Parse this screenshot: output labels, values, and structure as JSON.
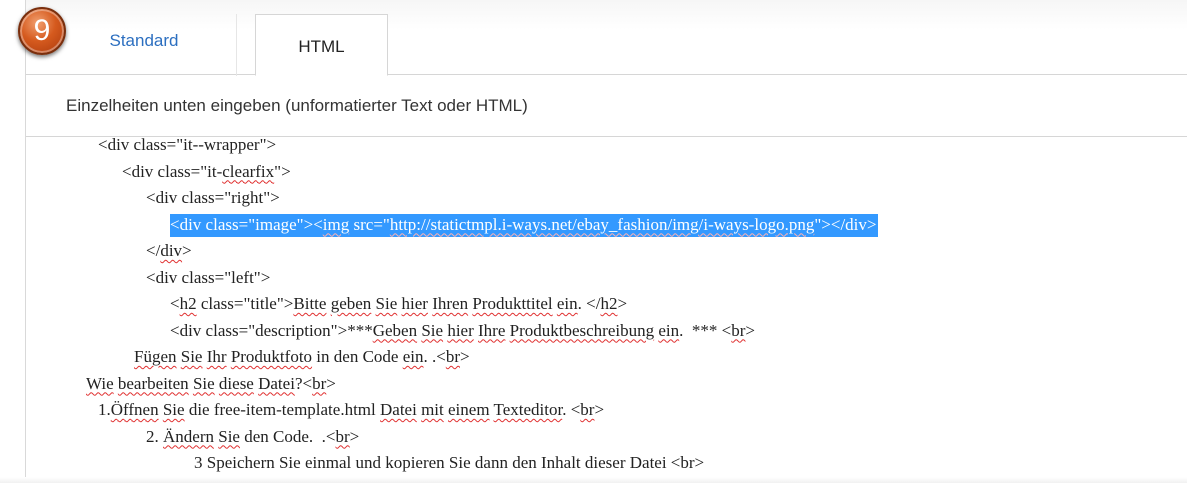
{
  "badge": {
    "number": "9"
  },
  "tabs": [
    {
      "label": "Standard",
      "active": false
    },
    {
      "label": "HTML",
      "active": true
    }
  ],
  "instructions": "Einzelheiten unten eingeben (unformatierter Text oder HTML)",
  "colors": {
    "selection": "#3399ff",
    "tab_link": "#2c6fc0",
    "badge": "#d55a1e",
    "spellcheck": "#e03030"
  },
  "code_lines": [
    {
      "indent": 1,
      "selected": false,
      "segments": [
        {
          "text": "<div class=\"it--wrapper\">",
          "spell": false
        }
      ]
    },
    {
      "indent": 2,
      "selected": false,
      "segments": [
        {
          "text": "<div class=\"it-",
          "spell": false
        },
        {
          "text": "clearfix",
          "spell": true
        },
        {
          "text": "\">",
          "spell": false
        }
      ]
    },
    {
      "indent": 3,
      "selected": false,
      "segments": [
        {
          "text": "<div class=\"right\">",
          "spell": false
        }
      ]
    },
    {
      "indent": 4,
      "selected": true,
      "segments": [
        {
          "text": "<div class=\"image\"><",
          "spell": false
        },
        {
          "text": "img",
          "spell": true
        },
        {
          "text": " src=\"",
          "spell": false
        },
        {
          "text": "http://statictmpl.i-ways.net/ebay_fashion/img/i-ways-logo.png",
          "spell": true
        },
        {
          "text": "\"></div>",
          "spell": false
        }
      ]
    },
    {
      "indent": 3,
      "selected": false,
      "segments": [
        {
          "text": "</",
          "spell": false
        },
        {
          "text": "div",
          "spell": true
        },
        {
          "text": ">",
          "spell": false
        }
      ]
    },
    {
      "indent": 3,
      "selected": false,
      "segments": [
        {
          "text": "<div class=\"left\">",
          "spell": false
        }
      ]
    },
    {
      "indent": 4,
      "selected": false,
      "segments": [
        {
          "text": "<",
          "spell": false
        },
        {
          "text": "h2",
          "spell": true
        },
        {
          "text": " class=\"title\">",
          "spell": false
        },
        {
          "text": "Bitte",
          "spell": true
        },
        {
          "text": " ",
          "spell": false
        },
        {
          "text": "geben",
          "spell": true
        },
        {
          "text": " ",
          "spell": false
        },
        {
          "text": "Sie",
          "spell": true
        },
        {
          "text": " ",
          "spell": false
        },
        {
          "text": "hier",
          "spell": true
        },
        {
          "text": " ",
          "spell": false
        },
        {
          "text": "Ihren",
          "spell": true
        },
        {
          "text": " ",
          "spell": false
        },
        {
          "text": "Produkttitel",
          "spell": true
        },
        {
          "text": " ",
          "spell": false
        },
        {
          "text": "ein",
          "spell": true
        },
        {
          "text": ". </",
          "spell": false
        },
        {
          "text": "h2",
          "spell": true
        },
        {
          "text": ">",
          "spell": false
        }
      ]
    },
    {
      "indent": 4,
      "selected": false,
      "segments": [
        {
          "text": "<div class=\"description\">***",
          "spell": false
        },
        {
          "text": "Geben",
          "spell": true
        },
        {
          "text": " ",
          "spell": false
        },
        {
          "text": "Sie",
          "spell": true
        },
        {
          "text": " ",
          "spell": false
        },
        {
          "text": "hier",
          "spell": true
        },
        {
          "text": " ",
          "spell": false
        },
        {
          "text": "Ihre",
          "spell": true
        },
        {
          "text": " ",
          "spell": false
        },
        {
          "text": "Produktbeschreibung",
          "spell": true
        },
        {
          "text": " ",
          "spell": false
        },
        {
          "text": "ein",
          "spell": true
        },
        {
          "text": ".  *** <",
          "spell": false
        },
        {
          "text": "br",
          "spell": true
        },
        {
          "text": ">",
          "spell": false
        }
      ]
    },
    {
      "indent": 2.5,
      "selected": false,
      "segments": [
        {
          "text": "Fügen",
          "spell": true
        },
        {
          "text": " ",
          "spell": false
        },
        {
          "text": "Sie",
          "spell": true
        },
        {
          "text": " ",
          "spell": false
        },
        {
          "text": "Ihr",
          "spell": true
        },
        {
          "text": " ",
          "spell": false
        },
        {
          "text": "Produktfoto",
          "spell": true
        },
        {
          "text": " in den Code ",
          "spell": false
        },
        {
          "text": "ein",
          "spell": true
        },
        {
          "text": ". .<",
          "spell": false
        },
        {
          "text": "br",
          "spell": true
        },
        {
          "text": ">",
          "spell": false
        }
      ]
    },
    {
      "indent": 0.5,
      "selected": false,
      "segments": [
        {
          "text": "Wie",
          "spell": true
        },
        {
          "text": " ",
          "spell": false
        },
        {
          "text": "bearbeiten",
          "spell": true
        },
        {
          "text": " ",
          "spell": false
        },
        {
          "text": "Sie",
          "spell": true
        },
        {
          "text": " ",
          "spell": false
        },
        {
          "text": "diese",
          "spell": true
        },
        {
          "text": " ",
          "spell": false
        },
        {
          "text": "Datei",
          "spell": true
        },
        {
          "text": "?<",
          "spell": false
        },
        {
          "text": "br",
          "spell": true
        },
        {
          "text": ">",
          "spell": false
        }
      ]
    },
    {
      "indent": 1,
      "selected": false,
      "segments": [
        {
          "text": "1.",
          "spell": false
        },
        {
          "text": "Öffnen",
          "spell": true
        },
        {
          "text": " ",
          "spell": false
        },
        {
          "text": "Sie",
          "spell": true
        },
        {
          "text": " die free-item-template.html ",
          "spell": false
        },
        {
          "text": "Datei",
          "spell": true
        },
        {
          "text": " ",
          "spell": false
        },
        {
          "text": "mit",
          "spell": true
        },
        {
          "text": " ",
          "spell": false
        },
        {
          "text": "einem",
          "spell": true
        },
        {
          "text": " ",
          "spell": false
        },
        {
          "text": "Texteditor",
          "spell": true
        },
        {
          "text": ". <",
          "spell": false
        },
        {
          "text": "br",
          "spell": true
        },
        {
          "text": ">",
          "spell": false
        }
      ]
    },
    {
      "indent": 3,
      "selected": false,
      "segments": [
        {
          "text": "2. ",
          "spell": false
        },
        {
          "text": "Ändern",
          "spell": true
        },
        {
          "text": " ",
          "spell": false
        },
        {
          "text": "Sie",
          "spell": true
        },
        {
          "text": " den Code.  .<",
          "spell": false
        },
        {
          "text": "br",
          "spell": true
        },
        {
          "text": ">",
          "spell": false
        }
      ]
    },
    {
      "indent": 5,
      "selected": false,
      "segments": [
        {
          "text": "3 Speichern Sie einmal und kopieren Sie dann den Inhalt dieser Datei <br>",
          "spell": false
        }
      ]
    }
  ]
}
